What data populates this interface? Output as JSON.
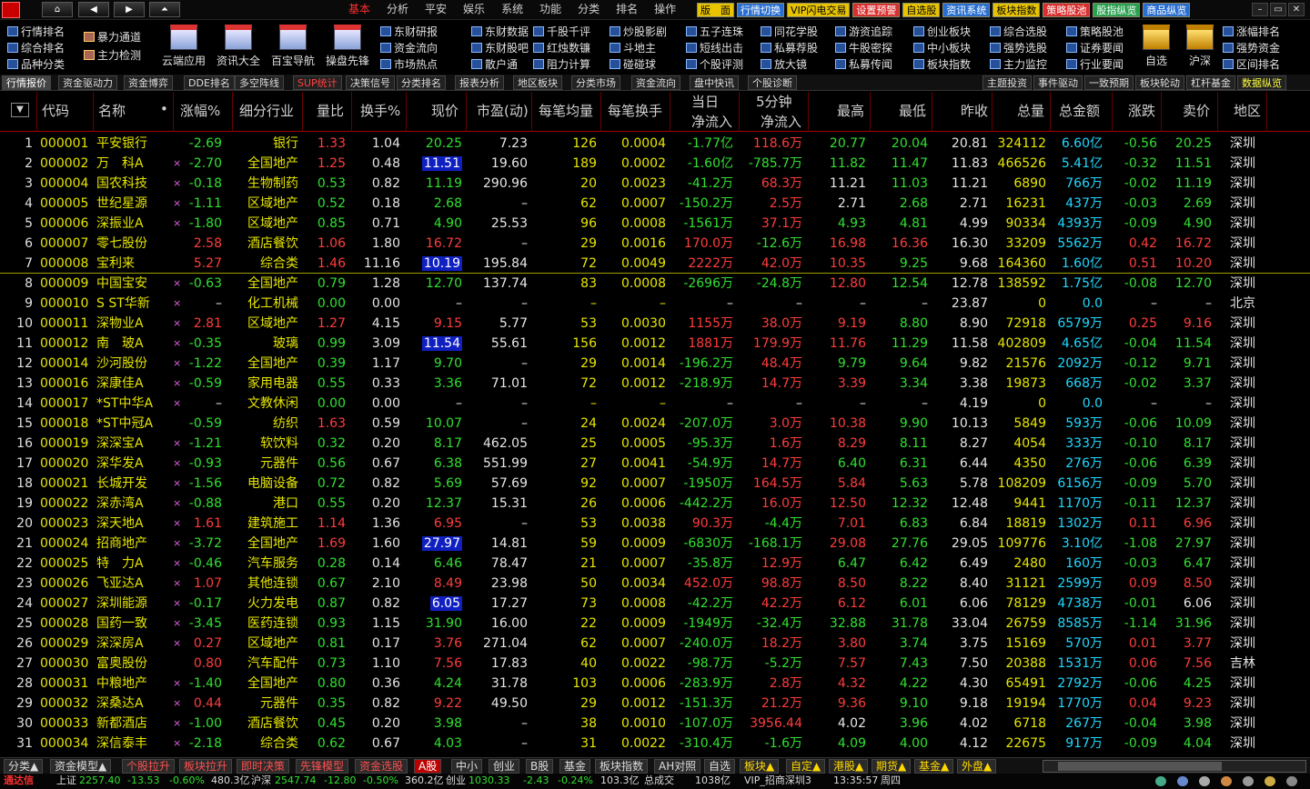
{
  "nav": {
    "home": "⌂",
    "back": "◀",
    "fwd": "▶",
    "up": "⏶"
  },
  "menu": [
    "基本",
    "分析",
    "平安",
    "娱乐",
    "系统",
    "功能",
    "分类",
    "排名",
    "操作"
  ],
  "pills": [
    {
      "label": "版　面",
      "cls": ""
    },
    {
      "label": "行情切换",
      "cls": "b"
    },
    {
      "label": "VIP闪电交易",
      "cls": ""
    },
    {
      "label": "设置预警",
      "cls": "r"
    },
    {
      "label": "自选股",
      "cls": ""
    },
    {
      "label": "资讯系统",
      "cls": "b"
    },
    {
      "label": "板块指数",
      "cls": ""
    },
    {
      "label": "策略股池",
      "cls": "r"
    },
    {
      "label": "股指纵览",
      "cls": "g"
    },
    {
      "label": "商品纵览",
      "cls": "b"
    }
  ],
  "win": {
    "min": "–",
    "max": "▭",
    "close": "✕"
  },
  "toolbar": {
    "left": [
      "行情排名",
      "综合排名",
      "品种分类"
    ],
    "left2": [
      "暴力通道",
      "主力检测"
    ],
    "big": [
      "云端应用",
      "资讯大全",
      "百宝导航",
      "操盘先锋"
    ],
    "cols": [
      [
        "东财研报",
        "资金流向",
        "市场热点"
      ],
      [
        "东财数据",
        "东财股吧",
        "散户通"
      ],
      [
        "千股千评",
        "红烛数镰",
        "阻力计算"
      ],
      [
        "炒股影剧",
        "斗地主",
        "碰碰球"
      ],
      [
        "五子连珠",
        "短线出击",
        "个股评测"
      ],
      [
        "同花学股",
        "私募荐股",
        "放大镜"
      ],
      [
        "游资追踪",
        "牛股密探",
        "私募传闻"
      ],
      [
        "创业板块",
        "中小板块",
        "板块指数"
      ],
      [
        "综合选股",
        "强势选股",
        "主力监控"
      ],
      [
        "策略股池",
        "证券要闻",
        "行业要闻"
      ]
    ],
    "right_big": [
      "自选",
      "沪深"
    ],
    "right": [
      "涨幅排名",
      "强势资金",
      "区间排名"
    ]
  },
  "tabs_left": [
    "行情报价",
    "资金驱动力",
    "资金博弈",
    "DDE排名",
    "多空阵线",
    "SUP统计",
    "决策信号",
    "分类排名",
    "报表分析",
    "地区板块",
    "分类市场",
    "资金流向",
    "盘中快讯",
    "个股诊断"
  ],
  "tabs_right": [
    "主题投资",
    "事件驱动",
    "一致预期",
    "板块轮动",
    "杠杆基金",
    "数据纵览"
  ],
  "header": {
    "sort": "▼",
    "code": "代码",
    "name": "名称",
    "dot": "•",
    "chg": "涨幅%",
    "ind": "细分行业",
    "vr": "量比",
    "tr": "换手%",
    "price": "现价",
    "pe": "市盈(动)",
    "avg": "每笔均量",
    "atr": "每笔换手",
    "day": "当日",
    "net": "净流入",
    "min5": "5分钟",
    "net5": "净流入",
    "high": "最高",
    "low": "最低",
    "prev": "昨收",
    "vol": "总量",
    "amt": "总金额",
    "diff": "涨跌",
    "sell": "卖价",
    "region": "地区"
  },
  "rows": [
    [
      "1",
      "000001",
      "平安银行",
      "",
      "-2.69",
      "银行",
      "1.33",
      "1.04",
      "20.25",
      "7.23",
      "126",
      "0.0004",
      "-1.77亿",
      "118.6万",
      "20.77",
      "20.04",
      "20.81",
      "324112",
      "6.60亿",
      "-0.56",
      "20.25",
      "深圳"
    ],
    [
      "2",
      "000002",
      "万　科A",
      "×",
      "-2.70",
      "全国地产",
      "1.25",
      "0.48",
      "11.51",
      "19.60",
      "189",
      "0.0002",
      "-1.60亿",
      "-785.7万",
      "11.82",
      "11.47",
      "11.83",
      "466526",
      "5.41亿",
      "-0.32",
      "11.51",
      "深圳"
    ],
    [
      "3",
      "000004",
      "国农科技",
      "×",
      "-0.18",
      "生物制药",
      "0.53",
      "0.82",
      "11.19",
      "290.96",
      "20",
      "0.0023",
      "-41.2万",
      "68.3万",
      "11.21",
      "11.03",
      "11.21",
      "6890",
      "766万",
      "-0.02",
      "11.19",
      "深圳"
    ],
    [
      "4",
      "000005",
      "世纪星源",
      "×",
      "-1.11",
      "区域地产",
      "0.52",
      "0.18",
      "2.68",
      "–",
      "62",
      "0.0007",
      "-150.2万",
      "2.5万",
      "2.71",
      "2.68",
      "2.71",
      "16231",
      "437万",
      "-0.03",
      "2.69",
      "深圳"
    ],
    [
      "5",
      "000006",
      "深振业A",
      "×",
      "-1.80",
      "区域地产",
      "0.85",
      "0.71",
      "4.90",
      "25.53",
      "96",
      "0.0008",
      "-1561万",
      "37.1万",
      "4.93",
      "4.81",
      "4.99",
      "90334",
      "4393万",
      "-0.09",
      "4.90",
      "深圳"
    ],
    [
      "6",
      "000007",
      "零七股份",
      "",
      "2.58",
      "酒店餐饮",
      "1.06",
      "1.80",
      "16.72",
      "–",
      "29",
      "0.0016",
      "170.0万",
      "-12.6万",
      "16.98",
      "16.36",
      "16.30",
      "33209",
      "5562万",
      "0.42",
      "16.72",
      "深圳"
    ],
    [
      "7",
      "000008",
      "宝利来",
      "",
      "5.27",
      "综合类",
      "1.46",
      "11.16",
      "10.19",
      "195.84",
      "72",
      "0.0049",
      "2222万",
      "42.0万",
      "10.35",
      "9.25",
      "9.68",
      "164360",
      "1.60亿",
      "0.51",
      "10.20",
      "深圳"
    ],
    [
      "8",
      "000009",
      "中国宝安",
      "×",
      "-0.63",
      "全国地产",
      "0.79",
      "1.28",
      "12.70",
      "137.74",
      "83",
      "0.0008",
      "-2696万",
      "-24.8万",
      "12.80",
      "12.54",
      "12.78",
      "138592",
      "1.75亿",
      "-0.08",
      "12.70",
      "深圳"
    ],
    [
      "9",
      "000010",
      "S ST华新",
      "×",
      "–",
      "化工机械",
      "0.00",
      "0.00",
      "–",
      "–",
      "–",
      "–",
      "–",
      "–",
      "–",
      "–",
      "23.87",
      "0",
      "0.0",
      "–",
      "–",
      "北京"
    ],
    [
      "10",
      "000011",
      "深物业A",
      "×",
      "2.81",
      "区域地产",
      "1.27",
      "4.15",
      "9.15",
      "5.77",
      "53",
      "0.0030",
      "1155万",
      "38.0万",
      "9.19",
      "8.80",
      "8.90",
      "72918",
      "6579万",
      "0.25",
      "9.16",
      "深圳"
    ],
    [
      "11",
      "000012",
      "南　玻A",
      "×",
      "-0.35",
      "玻璃",
      "0.99",
      "3.09",
      "11.54",
      "55.61",
      "156",
      "0.0012",
      "1881万",
      "179.9万",
      "11.76",
      "11.29",
      "11.58",
      "402809",
      "4.65亿",
      "-0.04",
      "11.54",
      "深圳"
    ],
    [
      "12",
      "000014",
      "沙河股份",
      "×",
      "-1.22",
      "全国地产",
      "0.39",
      "1.17",
      "9.70",
      "–",
      "29",
      "0.0014",
      "-196.2万",
      "48.4万",
      "9.79",
      "9.64",
      "9.82",
      "21576",
      "2092万",
      "-0.12",
      "9.71",
      "深圳"
    ],
    [
      "13",
      "000016",
      "深康佳A",
      "×",
      "-0.59",
      "家用电器",
      "0.55",
      "0.33",
      "3.36",
      "71.01",
      "72",
      "0.0012",
      "-218.9万",
      "14.7万",
      "3.39",
      "3.34",
      "3.38",
      "19873",
      "668万",
      "-0.02",
      "3.37",
      "深圳"
    ],
    [
      "14",
      "000017",
      "*ST中华A",
      "×",
      "–",
      "文教休闲",
      "0.00",
      "0.00",
      "–",
      "–",
      "–",
      "–",
      "–",
      "–",
      "–",
      "–",
      "4.19",
      "0",
      "0.0",
      "–",
      "–",
      "深圳"
    ],
    [
      "15",
      "000018",
      "*ST中冠A",
      "",
      "-0.59",
      "纺织",
      "1.63",
      "0.59",
      "10.07",
      "–",
      "24",
      "0.0024",
      "-207.0万",
      "3.0万",
      "10.38",
      "9.90",
      "10.13",
      "5849",
      "593万",
      "-0.06",
      "10.09",
      "深圳"
    ],
    [
      "16",
      "000019",
      "深深宝A",
      "×",
      "-1.21",
      "软饮料",
      "0.32",
      "0.20",
      "8.17",
      "462.05",
      "25",
      "0.0005",
      "-95.3万",
      "1.6万",
      "8.29",
      "8.11",
      "8.27",
      "4054",
      "333万",
      "-0.10",
      "8.17",
      "深圳"
    ],
    [
      "17",
      "000020",
      "深华发A",
      "×",
      "-0.93",
      "元器件",
      "0.56",
      "0.67",
      "6.38",
      "551.99",
      "27",
      "0.0041",
      "-54.9万",
      "14.7万",
      "6.40",
      "6.31",
      "6.44",
      "4350",
      "276万",
      "-0.06",
      "6.39",
      "深圳"
    ],
    [
      "18",
      "000021",
      "长城开发",
      "×",
      "-1.56",
      "电脑设备",
      "0.72",
      "0.82",
      "5.69",
      "57.69",
      "92",
      "0.0007",
      "-1950万",
      "164.5万",
      "5.84",
      "5.63",
      "5.78",
      "108209",
      "6156万",
      "-0.09",
      "5.70",
      "深圳"
    ],
    [
      "19",
      "000022",
      "深赤湾A",
      "×",
      "-0.88",
      "港口",
      "0.55",
      "0.20",
      "12.37",
      "15.31",
      "26",
      "0.0006",
      "-442.2万",
      "16.0万",
      "12.50",
      "12.32",
      "12.48",
      "9441",
      "1170万",
      "-0.11",
      "12.37",
      "深圳"
    ],
    [
      "20",
      "000023",
      "深天地A",
      "×",
      "1.61",
      "建筑施工",
      "1.14",
      "1.36",
      "6.95",
      "–",
      "53",
      "0.0038",
      "90.3万",
      "-4.4万",
      "7.01",
      "6.83",
      "6.84",
      "18819",
      "1302万",
      "0.11",
      "6.96",
      "深圳"
    ],
    [
      "21",
      "000024",
      "招商地产",
      "×",
      "-3.72",
      "全国地产",
      "1.69",
      "1.60",
      "27.97",
      "14.81",
      "59",
      "0.0009",
      "-6830万",
      "-168.1万",
      "29.08",
      "27.76",
      "29.05",
      "109776",
      "3.10亿",
      "-1.08",
      "27.97",
      "深圳"
    ],
    [
      "22",
      "000025",
      "特　力A",
      "×",
      "-0.46",
      "汽车服务",
      "0.28",
      "0.14",
      "6.46",
      "78.47",
      "21",
      "0.0007",
      "-35.8万",
      "12.9万",
      "6.47",
      "6.42",
      "6.49",
      "2480",
      "160万",
      "-0.03",
      "6.47",
      "深圳"
    ],
    [
      "23",
      "000026",
      "飞亚达A",
      "×",
      "1.07",
      "其他连锁",
      "0.67",
      "2.10",
      "8.49",
      "23.98",
      "50",
      "0.0034",
      "452.0万",
      "98.8万",
      "8.50",
      "8.22",
      "8.40",
      "31121",
      "2599万",
      "0.09",
      "8.50",
      "深圳"
    ],
    [
      "24",
      "000027",
      "深圳能源",
      "×",
      "-0.17",
      "火力发电",
      "0.87",
      "0.82",
      "6.05",
      "17.27",
      "73",
      "0.0008",
      "-42.2万",
      "42.2万",
      "6.12",
      "6.01",
      "6.06",
      "78129",
      "4738万",
      "-0.01",
      "6.06",
      "深圳"
    ],
    [
      "25",
      "000028",
      "国药一致",
      "×",
      "-3.45",
      "医药连锁",
      "0.93",
      "1.15",
      "31.90",
      "16.00",
      "22",
      "0.0009",
      "-1949万",
      "-32.4万",
      "32.88",
      "31.78",
      "33.04",
      "26759",
      "8585万",
      "-1.14",
      "31.96",
      "深圳"
    ],
    [
      "26",
      "000029",
      "深深房A",
      "×",
      "0.27",
      "区域地产",
      "0.81",
      "0.17",
      "3.76",
      "271.04",
      "62",
      "0.0007",
      "-240.0万",
      "18.2万",
      "3.80",
      "3.74",
      "3.75",
      "15169",
      "570万",
      "0.01",
      "3.77",
      "深圳"
    ],
    [
      "27",
      "000030",
      "富奥股份",
      "",
      "0.80",
      "汽车配件",
      "0.73",
      "1.10",
      "7.56",
      "17.83",
      "40",
      "0.0022",
      "-98.7万",
      "-5.2万",
      "7.57",
      "7.43",
      "7.50",
      "20388",
      "1531万",
      "0.06",
      "7.56",
      "吉林"
    ],
    [
      "28",
      "000031",
      "中粮地产",
      "×",
      "-1.40",
      "全国地产",
      "0.80",
      "0.36",
      "4.24",
      "31.78",
      "103",
      "0.0006",
      "-283.9万",
      "2.8万",
      "4.32",
      "4.22",
      "4.30",
      "65491",
      "2792万",
      "-0.06",
      "4.25",
      "深圳"
    ],
    [
      "29",
      "000032",
      "深桑达A",
      "×",
      "0.44",
      "元器件",
      "0.35",
      "0.82",
      "9.22",
      "49.50",
      "29",
      "0.0012",
      "-151.3万",
      "21.2万",
      "9.36",
      "9.10",
      "9.18",
      "19194",
      "1770万",
      "0.04",
      "9.23",
      "深圳"
    ],
    [
      "30",
      "000033",
      "新都酒店",
      "×",
      "-1.00",
      "酒店餐饮",
      "0.45",
      "0.20",
      "3.98",
      "–",
      "38",
      "0.0010",
      "-107.0万",
      "3956.44",
      "4.02",
      "3.96",
      "4.02",
      "6718",
      "267万",
      "-0.04",
      "3.98",
      "深圳"
    ],
    [
      "31",
      "000034",
      "深信泰丰",
      "×",
      "-2.18",
      "综合类",
      "0.62",
      "0.67",
      "4.03",
      "–",
      "31",
      "0.0022",
      "-310.4万",
      "-1.6万",
      "4.09",
      "4.00",
      "4.12",
      "22675",
      "917万",
      "-0.09",
      "4.04",
      "深圳"
    ]
  ],
  "highlight_rows": [
    2,
    7,
    11,
    21,
    24
  ],
  "bottom_tabs": [
    "分类▲",
    "资金模型▲",
    "个股拉升",
    "板块拉升",
    "即时决策",
    "先锋模型",
    "资金选股",
    "A股",
    "中小",
    "创业",
    "B股",
    "基金",
    "板块指数",
    "AH对照",
    "自选",
    "板块▲",
    "自定▲",
    "港股▲",
    "期货▲",
    "基金▲",
    "外盘▲"
  ],
  "status": {
    "brand": "通达信",
    "sh_label": "上证",
    "sh_val": "2257.40",
    "sh_chg": "-13.53",
    "sh_pct": "-0.60%",
    "sh_amt": "480.3亿",
    "sz_label": "沪深",
    "sz_val": "2547.74",
    "sz_chg": "-12.80",
    "sz_pct": "-0.50%",
    "sz_amt": "360.2亿",
    "cy_label": "创业",
    "cy_val": "1030.33",
    "cy_chg": "-2.43",
    "cy_pct": "-0.24%",
    "cy_amt": "103.3亿",
    "total_label": "总成交",
    "total_val": "1038亿",
    "server": "VIP_招商深圳3",
    "time": "13:35:57",
    "weekday": "周四"
  }
}
